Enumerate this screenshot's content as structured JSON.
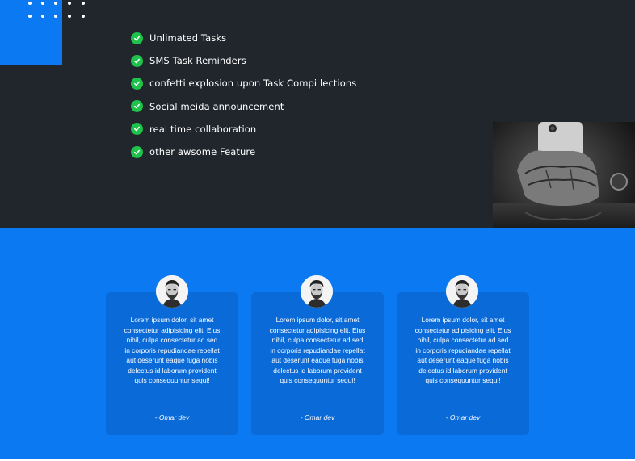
{
  "features": [
    {
      "label": "Unlimated Tasks",
      "icon": "check-circle-icon"
    },
    {
      "label": "SMS Task Reminders",
      "icon": "check-circle-icon"
    },
    {
      "label": "confetti explosion upon Task Compi lections",
      "icon": "check-circle-icon"
    },
    {
      "label": "Social meida announcement",
      "icon": "check-circle-icon"
    },
    {
      "label": "real time collaboration",
      "icon": "check-circle-icon"
    },
    {
      "label": "other awsome Feature",
      "icon": "check-circle-icon"
    }
  ],
  "testimonials": [
    {
      "text": "Lorem ipsum dolor, sit amet consectetur adipisicing elit. Eius nihil, culpa consectetur ad sed in corporis repudiandae repellat aut deserunt eaque fuga nobis delectus id laborum provident quis consequuntur sequi!",
      "author": "- Omar dev"
    },
    {
      "text": "Lorem ipsum dolor, sit amet consectetur adipisicing elit. Eius nihil, culpa consectetur ad sed in corporis repudiandae repellat aut deserunt eaque fuga nobis delectus id laborum provident quis consequuntur sequi!",
      "author": "- Omar dev"
    },
    {
      "text": "Lorem ipsum dolor, sit amet consectetur adipisicing elit. Eius nihil, culpa consectetur ad sed in corporis repudiandae repellat aut deserunt eaque fuga nobis delectus id laborum provident quis consequuntur sequi!",
      "author": "- Omar dev"
    }
  ],
  "colors": {
    "dark_bg": "#21262d",
    "brand_blue": "#0b79f2",
    "card_blue": "#0a6ad8",
    "check_green": "#1fc24a"
  }
}
